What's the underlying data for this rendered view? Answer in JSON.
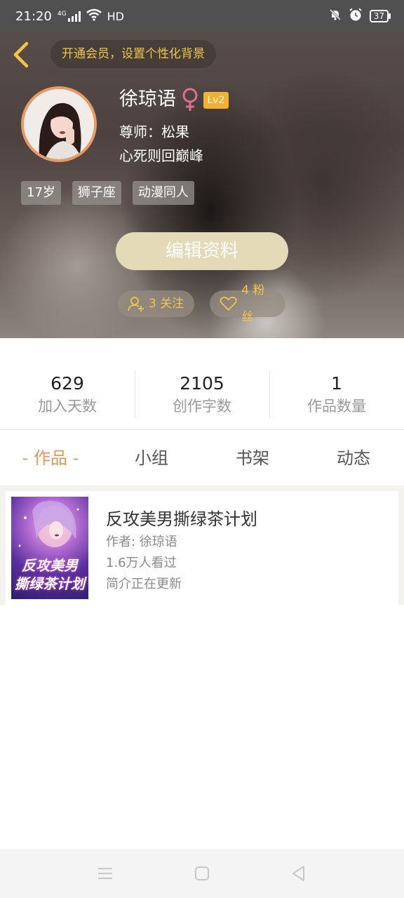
{
  "status_bar": {
    "time": "21:20",
    "network": "4G",
    "hd": "HD",
    "battery": "37"
  },
  "header": {
    "vip_prompt": "开通会员，设置个性化背景"
  },
  "profile": {
    "name": "徐琼语",
    "gender_icon": "female-icon",
    "level": "Lv2",
    "teacher": "尊师：松果",
    "signature": "心死则回巅峰",
    "tags": [
      "17岁",
      "狮子座",
      "动漫同人"
    ],
    "edit_label": "编辑资料",
    "follow_label": "3 关注",
    "fans_label": "4 粉丝"
  },
  "stats": [
    {
      "value": "629",
      "label": "加入天数"
    },
    {
      "value": "2105",
      "label": "创作字数"
    },
    {
      "value": "1",
      "label": "作品数量"
    }
  ],
  "tabs": [
    "- 作品 -",
    "小组",
    "书架",
    "动态"
  ],
  "active_tab": 0,
  "works": [
    {
      "title": "反攻美男撕绿茶计划",
      "author": "作者: 徐琼语",
      "views": "1.6万人看过",
      "intro": "简介正在更新",
      "cover_line1": "反攻美男",
      "cover_line2": "撕绿茶计划"
    }
  ],
  "colors": {
    "accent": "#e8955c",
    "vip_text": "#f0c64a",
    "level_badge": "#f2b22f",
    "edit_button": "#e5dab8",
    "female": "#e26d8b"
  },
  "navbar_icons": [
    "menu-icon",
    "home-icon",
    "back-icon"
  ]
}
